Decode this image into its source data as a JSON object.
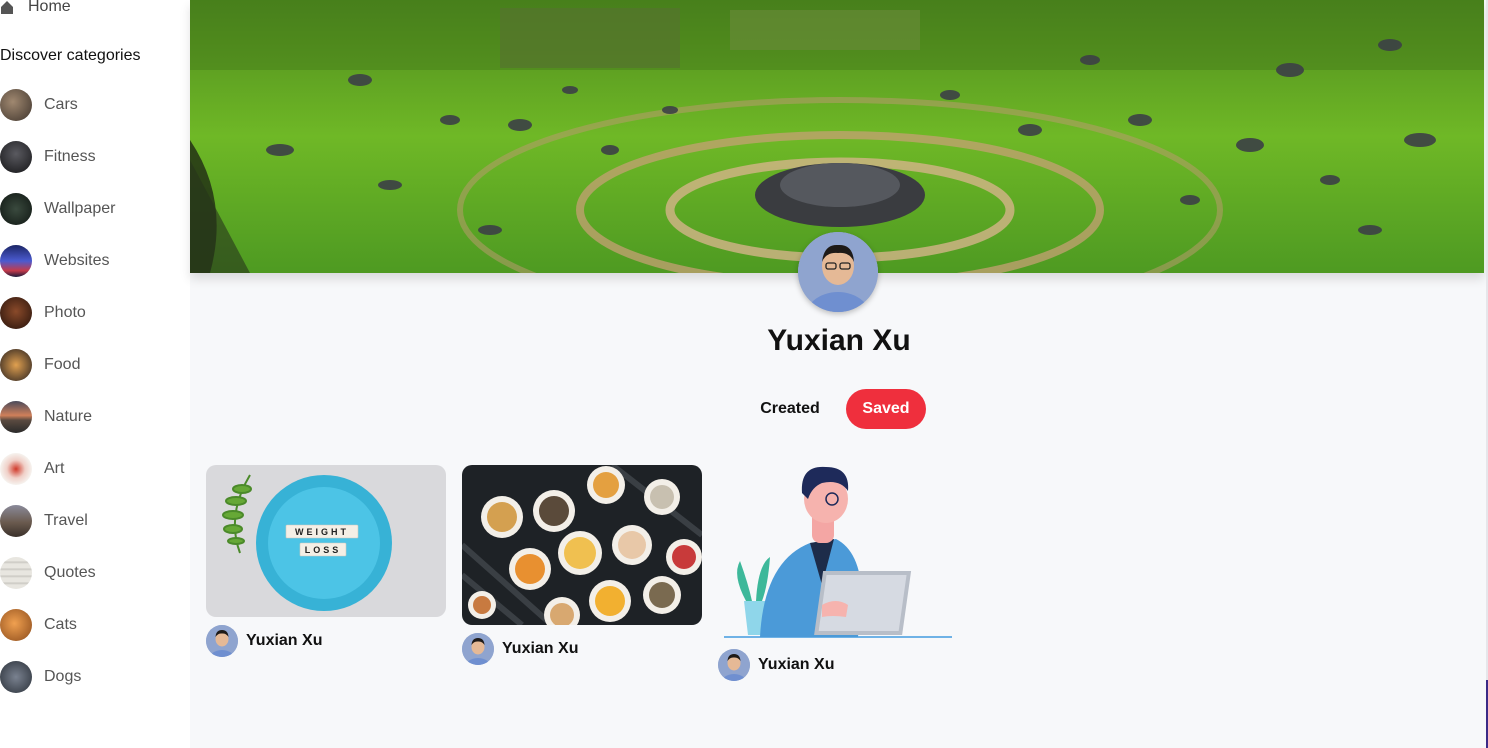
{
  "nav": {
    "home_label": "Home"
  },
  "sidebar": {
    "title": "Discover categories",
    "categories": [
      {
        "label": "Cars",
        "color": "#6b5a4a"
      },
      {
        "label": "Fitness",
        "color": "#2b2b2e"
      },
      {
        "label": "Wallpaper",
        "color": "#1d2a22"
      },
      {
        "label": "Websites",
        "color": "#2c3a7a"
      },
      {
        "label": "Photo",
        "color": "#4a2416"
      },
      {
        "label": "Food",
        "color": "#b46a2c"
      },
      {
        "label": "Nature",
        "color": "#8a5a4a"
      },
      {
        "label": "Art",
        "color": "#d94a3a"
      },
      {
        "label": "Travel",
        "color": "#6a5a4e"
      },
      {
        "label": "Quotes",
        "color": "#d8d8d2"
      },
      {
        "label": "Cats",
        "color": "#c8782e"
      },
      {
        "label": "Dogs",
        "color": "#4a5160"
      }
    ]
  },
  "profile": {
    "name": "Yuxian Xu",
    "tabs": {
      "created": "Created",
      "saved": "Saved"
    },
    "active_tab": "Saved",
    "accent_color": "#ef2f3d"
  },
  "pins": [
    {
      "title_hidden": false,
      "image": "weight-loss-plate",
      "author": "Yuxian Xu",
      "image_text": [
        "WEIGHT",
        "LOSS"
      ]
    },
    {
      "title_hidden": false,
      "image": "food-bowls",
      "author": "Yuxian Xu"
    },
    {
      "title_hidden": false,
      "image": "man-with-laptop-illustration",
      "author": "Yuxian Xu"
    }
  ]
}
